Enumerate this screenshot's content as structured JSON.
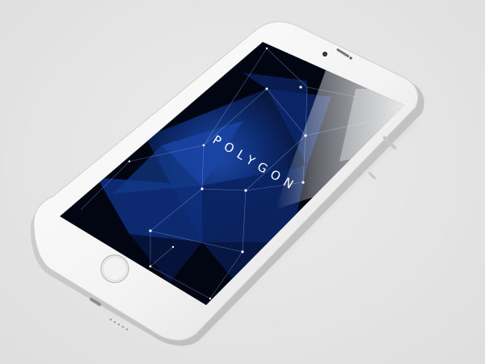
{
  "app": {
    "title": "POLYGON"
  },
  "colors": {
    "background": "#e6e6e6",
    "phone_body": "#f4f4f4",
    "screen_dark": "#020612",
    "screen_blue": "#123a8a",
    "accent_white": "#ffffff"
  },
  "icons": {
    "home_button": "home-button-icon",
    "camera": "front-camera-icon",
    "speaker": "earpiece-speaker-icon"
  }
}
